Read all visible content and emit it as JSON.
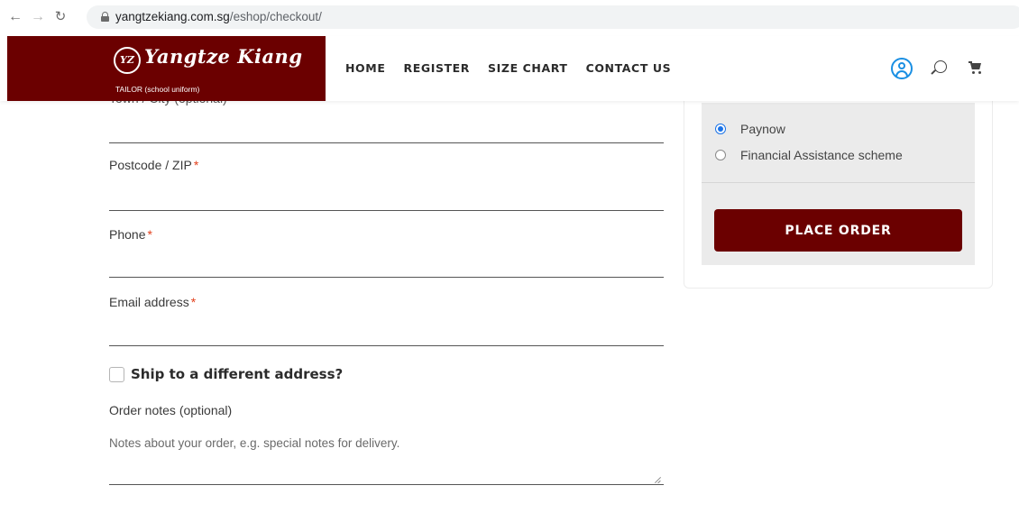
{
  "browser": {
    "url_domain": "yangtzekiang.com.sg",
    "url_path": "/eshop/checkout/"
  },
  "header": {
    "logo_emblem": "YZ",
    "logo_name": "Yangtze Kiang",
    "logo_subtitle": "TAILOR (school uniform)",
    "nav": [
      "HOME",
      "REGISTER",
      "SIZE CHART",
      "CONTACT US"
    ],
    "accent_color": "#6b0000",
    "user_icon_color": "#1a8fe3"
  },
  "form": {
    "town_label": "Town / City (optional)",
    "postcode_label": "Postcode / ZIP",
    "phone_label": "Phone",
    "email_label": "Email address",
    "required_marker": "*",
    "ship_different_label": "Ship to a different address?",
    "order_notes_label": "Order notes (optional)",
    "order_notes_placeholder": "Notes about your order, e.g. special notes for delivery."
  },
  "payment": {
    "methods": [
      {
        "label": "Paynow",
        "selected": true
      },
      {
        "label": "Financial Assistance scheme",
        "selected": false
      }
    ],
    "place_order_label": "PLACE ORDER"
  }
}
